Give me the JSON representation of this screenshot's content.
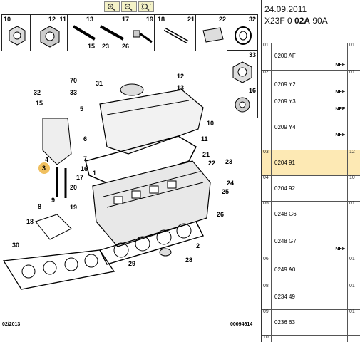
{
  "header": {
    "date": "24.09.2011",
    "code_prefix": "X23F 0 ",
    "code_bold": "02A",
    "code_suffix": " 90A"
  },
  "toolbar": {
    "zoom_in_icon": "zoom-in-icon",
    "zoom_out_icon": "zoom-out-icon",
    "zoom_fit_icon": "zoom-fit-icon"
  },
  "part_numbers": {
    "cell1": "10",
    "cell2_l": "12",
    "cell2_r": "11",
    "cell3_tl": "13",
    "cell3_tr": "17",
    "cell3_bl": "15",
    "cell3_bm": "23",
    "cell3_br": "26",
    "cell4": "19",
    "cell5_l": "18",
    "cell5_r": "21",
    "cell6": "22",
    "cell7": "32",
    "cell8": "33",
    "cell9": "16"
  },
  "callouts": {
    "c70": "70",
    "c12": "12",
    "c31": "31",
    "c13": "13",
    "c32": "32",
    "c33": "33",
    "c15": "15",
    "c5": "5",
    "c10": "10",
    "c11": "11",
    "c6": "6",
    "c7": "7",
    "c21": "21",
    "c22": "22",
    "c4": "4",
    "c3": "3",
    "c16": "16",
    "c23": "23",
    "c1": "1",
    "c24": "24",
    "c17": "17",
    "c20": "20",
    "c25": "25",
    "c8": "8",
    "c9": "9",
    "c19": "19",
    "c26": "26",
    "c18": "18",
    "c30": "30",
    "c2": "2",
    "c29": "29",
    "c28": "28"
  },
  "diagram_footer": {
    "left": "02/2013",
    "right": "00094614"
  },
  "parts_list": [
    {
      "idx": "01",
      "ref": "0200 AF",
      "tag": "NFF",
      "qty": "01"
    },
    {
      "idx": "02",
      "ref": "0209 Y2",
      "tag": "NFF",
      "qty": "01"
    },
    {
      "idx": "",
      "ref": "0209 Y3",
      "tag": "NFF",
      "qty": "01"
    },
    {
      "idx": "",
      "ref": "0209 Y4",
      "tag": "NFF",
      "qty": "01"
    },
    {
      "idx": "03",
      "ref": "0204 91",
      "tag": "",
      "qty": "12"
    },
    {
      "idx": "04",
      "ref": "0204 92",
      "tag": "",
      "qty": "10"
    },
    {
      "idx": "05",
      "ref": "0248 G6",
      "tag": "",
      "qty": "01"
    },
    {
      "idx": "",
      "ref": "0248 G7",
      "tag": "NFF",
      "qty": "01"
    },
    {
      "idx": "06",
      "ref": "0249 A0",
      "tag": "",
      "qty": "01"
    },
    {
      "idx": "08",
      "ref": "0234 49",
      "tag": "",
      "qty": "01"
    },
    {
      "idx": "09",
      "ref": "0236 63",
      "tag": "",
      "qty": "01"
    },
    {
      "idx": "10",
      "ref": "",
      "tag": "",
      "qty": ""
    }
  ],
  "colors": {
    "selected_row": "#fde9b4",
    "toolbar_bg": "#f4f2c8",
    "marker_circle": "#f0c060"
  }
}
